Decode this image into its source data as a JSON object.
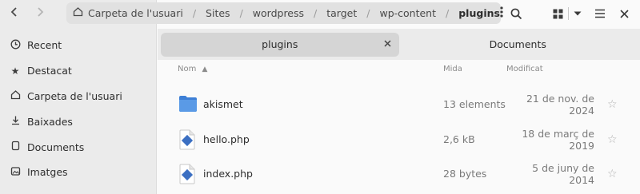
{
  "sidebar": {
    "items": [
      {
        "label": "Recent",
        "icon": "clock-icon"
      },
      {
        "label": "Destacat",
        "icon": "star-icon"
      },
      {
        "label": "Carpeta de l'usuari",
        "icon": "home-icon"
      },
      {
        "label": "Baixades",
        "icon": "download-icon"
      },
      {
        "label": "Documents",
        "icon": "document-icon"
      },
      {
        "label": "Imatges",
        "icon": "image-icon"
      }
    ]
  },
  "pathbar": {
    "crumbs": [
      "Carpeta de l'usuari",
      "Sites",
      "wordpress",
      "target",
      "wp-content",
      "plugins"
    ]
  },
  "tabs": [
    {
      "label": "plugins",
      "active": true
    },
    {
      "label": "Documents",
      "active": false
    }
  ],
  "columns": {
    "name": "Nom",
    "size": "Mida",
    "modified": "Modificat"
  },
  "files": [
    {
      "name": "akismet",
      "size": "13 elements",
      "modified": "21 de nov. de 2024",
      "type": "folder"
    },
    {
      "name": "hello.php",
      "size": "2,6 kB",
      "modified": "18 de març de 2019",
      "type": "php"
    },
    {
      "name": "index.php",
      "size": "28 bytes",
      "modified": "5 de juny de 2014",
      "type": "php"
    }
  ],
  "colors": {
    "folder": "#4a8ee0",
    "php_badge": "#3b6fc2"
  }
}
